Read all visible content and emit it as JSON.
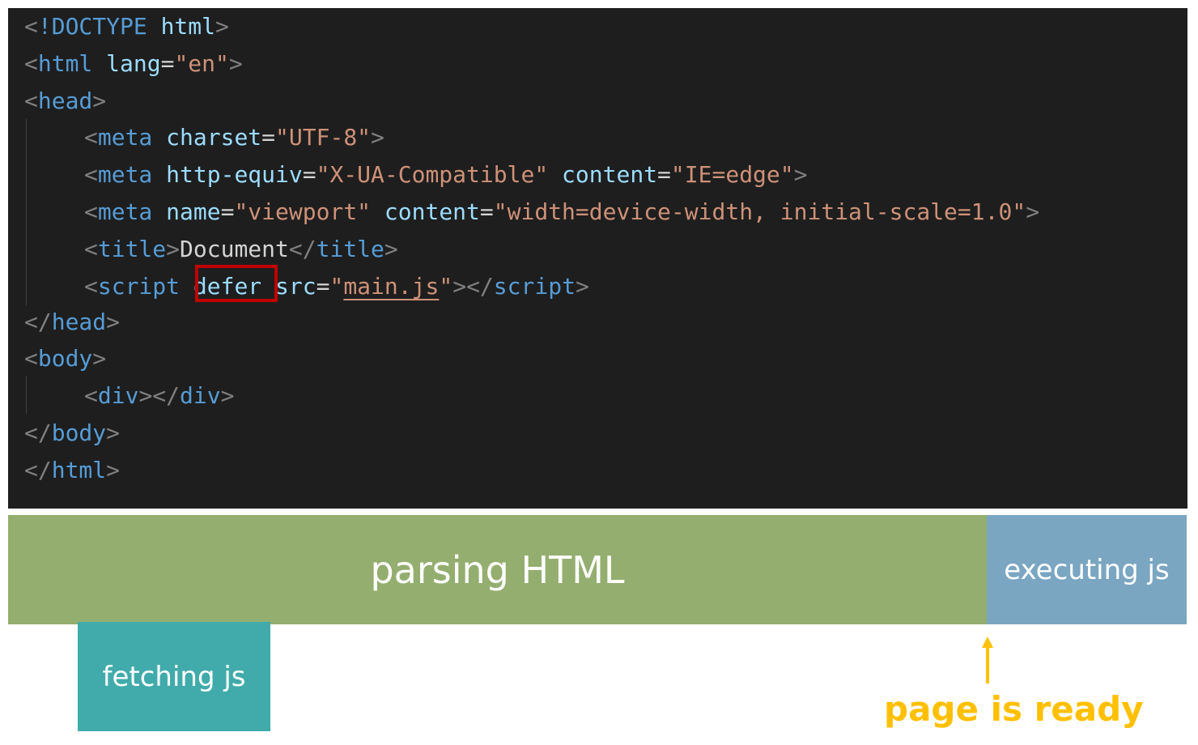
{
  "code": {
    "l1": {
      "lt": "<",
      "doctype": "!DOCTYPE",
      "sp": " ",
      "html": "html",
      "gt": ">"
    },
    "l2": {
      "lt": "<",
      "tag": "html",
      "attr": "lang",
      "eq": "=",
      "val": "\"en\"",
      "gt": ">"
    },
    "l3": {
      "lt": "<",
      "tag": "head",
      "gt": ">"
    },
    "l4": {
      "lt": "<",
      "tag": "meta",
      "attr": "charset",
      "eq": "=",
      "val": "\"UTF-8\"",
      "gt": ">"
    },
    "l5": {
      "lt": "<",
      "tag": "meta",
      "attr1": "http-equiv",
      "eq": "=",
      "val1": "\"X-UA-Compatible\"",
      "attr2": "content",
      "val2": "\"IE=edge\"",
      "gt": ">"
    },
    "l6": {
      "lt": "<",
      "tag": "meta",
      "attr1": "name",
      "eq": "=",
      "val1": "\"viewport\"",
      "attr2": "content",
      "val2": "\"width=device-width, initial-scale=1.0\"",
      "gt": ">"
    },
    "l7": {
      "lt": "<",
      "tag": "title",
      "gt": ">",
      "text": "Document",
      "close_lt": "</",
      "close_tag": "title",
      "close_gt": ">"
    },
    "l8": {
      "lt": "<",
      "tag": "script",
      "attr1": "defer",
      "attr2": "src",
      "eq": "=",
      "quote_open": "\"",
      "val": "main.js",
      "quote_close": "\"",
      "gt": ">",
      "close_lt": "</",
      "close_tag": "script",
      "close_gt": ">"
    },
    "l9": {
      "lt": "</",
      "tag": "head",
      "gt": ">"
    },
    "l10": {
      "lt": "<",
      "tag": "body",
      "gt": ">"
    },
    "l11": {
      "lt": "<",
      "tag": "div",
      "gt": ">",
      "close_lt": "</",
      "close_tag": "div",
      "close_gt": ">"
    },
    "l12": {
      "lt": "</",
      "tag": "body",
      "gt": ">"
    },
    "l13": {
      "lt": "</",
      "tag": "html",
      "gt": ">"
    }
  },
  "timeline": {
    "parsing": "parsing HTML",
    "executing": "executing js",
    "fetching": "fetching js",
    "ready": "page is ready"
  },
  "colors": {
    "parsing": "#94ae6f",
    "executing": "#7aa6c2",
    "fetching": "#41abab",
    "ready": "#ffc000",
    "highlight": "#c00000"
  }
}
